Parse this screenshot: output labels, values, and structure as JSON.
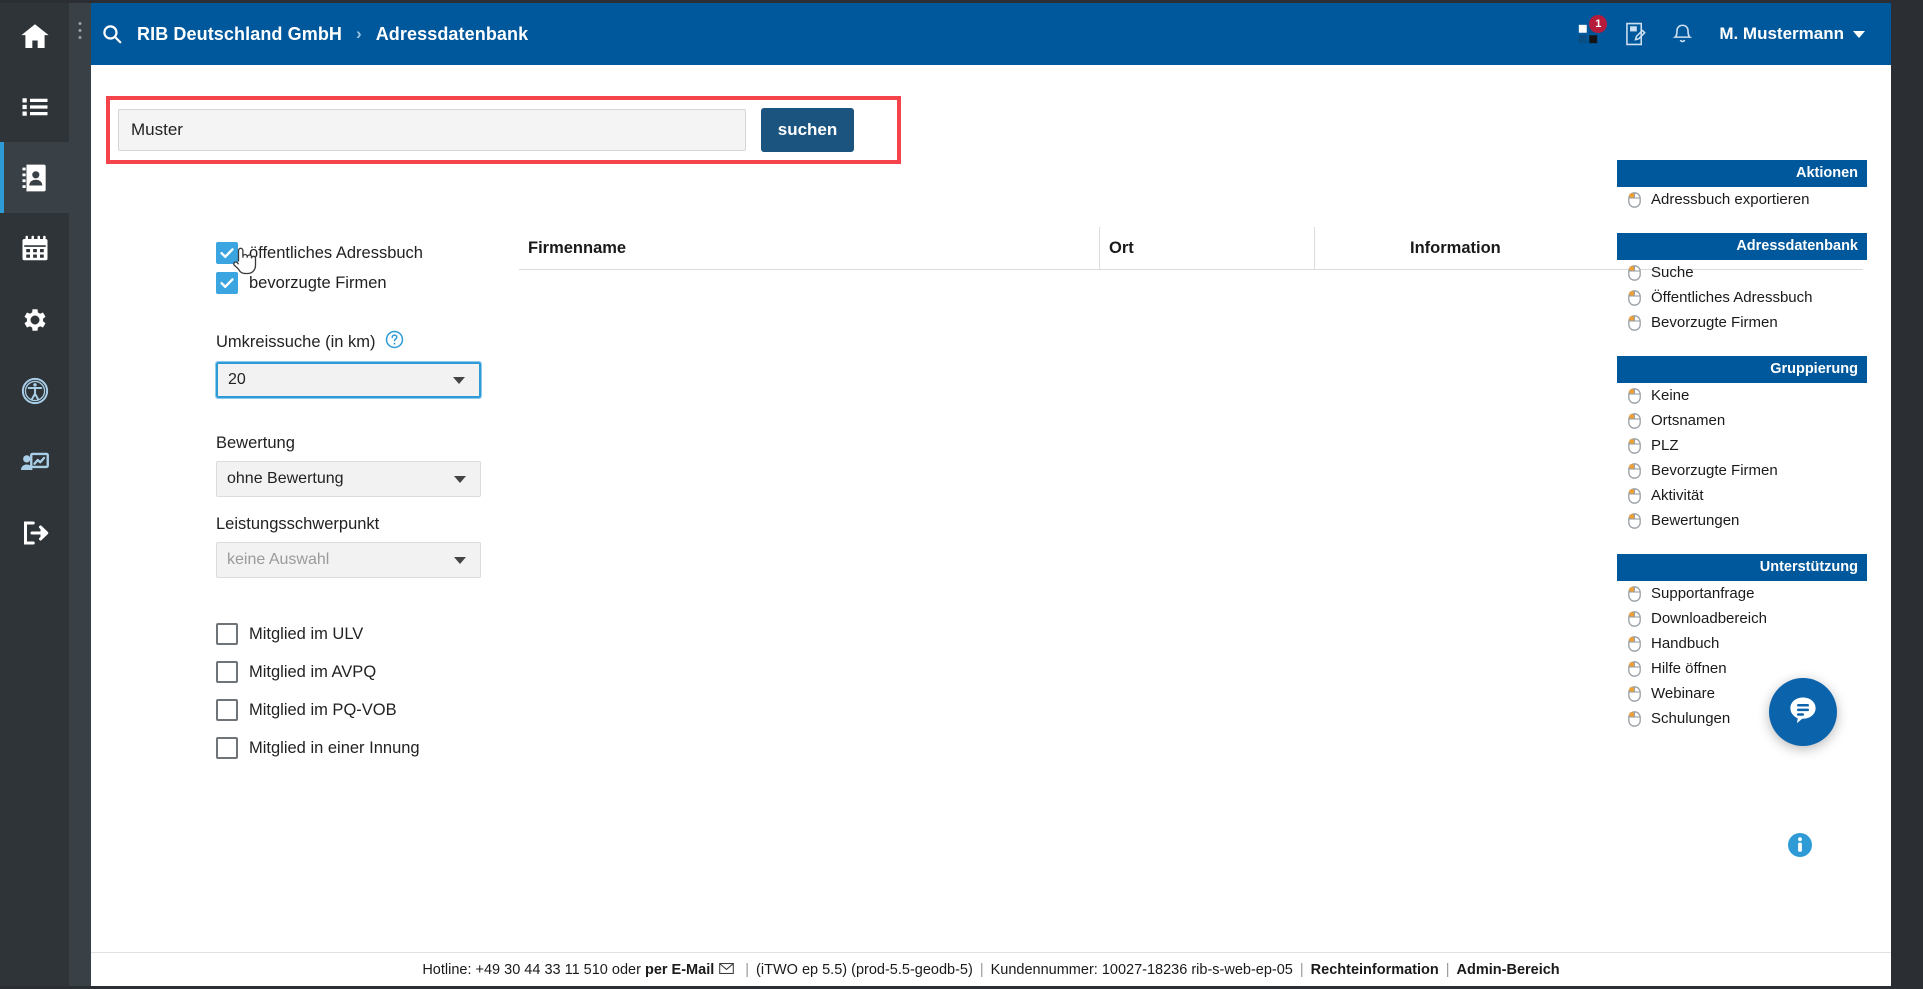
{
  "topbar": {
    "search_icon": "search-icon",
    "breadcrumb": {
      "root": "RIB Deutschland GmbH",
      "separator": "›",
      "current": "Adressdatenbank"
    },
    "apps_icon": "apps-grid-icon",
    "apps_badge": "1",
    "notes_icon": "note-edit-icon",
    "bell_icon": "bell-icon",
    "user": "M. Mustermann",
    "user_caret": "chevron-down-icon",
    "accent": "#00589c"
  },
  "rail": {
    "items": [
      {
        "name": "home-icon",
        "active": false
      },
      {
        "name": "list-icon",
        "active": false
      },
      {
        "name": "address-book-icon",
        "active": true
      },
      {
        "name": "calendar-icon",
        "active": false
      },
      {
        "name": "gear-icon",
        "active": false
      },
      {
        "name": "accessibility-icon",
        "active": false
      },
      {
        "name": "presentation-user-icon",
        "active": false
      },
      {
        "name": "logout-icon",
        "active": false
      }
    ],
    "handle": "drag-handle-dots"
  },
  "search": {
    "value": "Muster",
    "placeholder": "",
    "button_label": "suchen",
    "highlight_color": "#f4434a",
    "button_color": "#1c5480"
  },
  "filters": {
    "checkboxes_top": [
      {
        "label": "öffentliches Adressbuch",
        "checked": true
      },
      {
        "label": "bevorzugte Firmen",
        "checked": true
      }
    ],
    "radius": {
      "label": "Umkreissuche (in km)",
      "help_icon": "help-circle-icon",
      "value": "20",
      "focused": true
    },
    "rating": {
      "label": "Bewertung",
      "value": "ohne Bewertung"
    },
    "focus": {
      "label": "Leistungsschwerpunkt",
      "value": "keine Auswahl",
      "is_placeholder": true
    },
    "checkboxes_bottom": [
      {
        "label": "Mitglied im ULV",
        "checked": false
      },
      {
        "label": "Mitglied im AVPQ",
        "checked": false
      },
      {
        "label": "Mitglied im PQ-VOB",
        "checked": false
      },
      {
        "label": "Mitglied in einer Innung",
        "checked": false
      }
    ]
  },
  "results": {
    "columns": [
      "Firmenname",
      "Ort",
      "Information"
    ],
    "rows": []
  },
  "sidebar": {
    "panels": [
      {
        "title": "Aktionen",
        "items": [
          "Adressbuch exportieren"
        ]
      },
      {
        "title": "Adressdatenbank",
        "items": [
          "Suche",
          "Öffentliches Adressbuch",
          "Bevorzugte Firmen"
        ]
      },
      {
        "title": "Gruppierung",
        "items": [
          "Keine",
          "Ortsnamen",
          "PLZ",
          "Bevorzugte Firmen",
          "Aktivität",
          "Bewertungen"
        ]
      },
      {
        "title": "Unterstützung",
        "items": [
          "Supportanfrage",
          "Downloadbereich",
          "Handbuch",
          "Hilfe öffnen",
          "Webinare",
          "Schulungen"
        ]
      }
    ]
  },
  "floating": {
    "chat_icon": "chat-bubble-icon",
    "info_icon": "info-circle-icon"
  },
  "footer": {
    "hotline": "Hotline: +49 30 44 33 11 510 oder",
    "email_link": "per E-Mail",
    "email_icon": "envelope-icon",
    "version": "(iTWO ep 5.5) (prod-5.5-geodb-5)",
    "customer": "Kundennummer: 10027-18236 rib-s-web-ep-05",
    "legal_link": "Rechteinformation",
    "admin_link": "Admin-Bereich",
    "separator": "|"
  }
}
